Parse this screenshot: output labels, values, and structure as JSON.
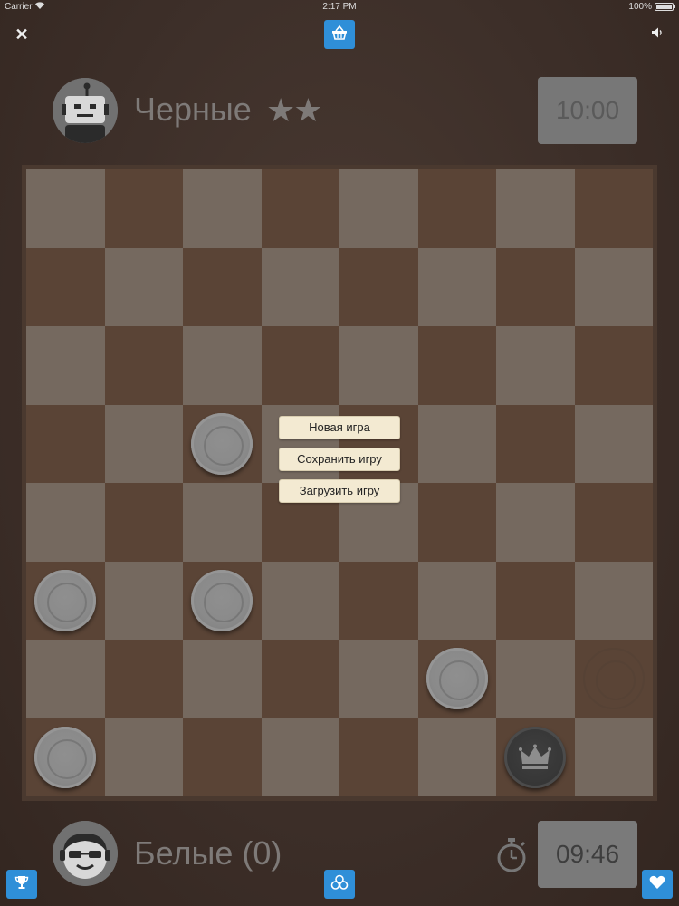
{
  "status_bar": {
    "carrier": "Carrier",
    "time": "2:17 PM",
    "battery": "100%"
  },
  "top_player": {
    "name": "Черные",
    "stars": "★★",
    "clock": "10:00",
    "avatar": "robot-icon"
  },
  "bottom_player": {
    "name": "Белые (0)",
    "clock": "09:46",
    "avatar": "sunglasses-face-icon"
  },
  "menu": {
    "new_game": "Новая игра",
    "save_game": "Сохранить игру",
    "load_game": "Загрузить игру"
  },
  "icons": {
    "close": "close-icon",
    "shop": "basket-icon",
    "sound": "speaker-icon",
    "trophy": "trophy-icon",
    "coins": "coins-icon",
    "heart": "heart-icon",
    "stopwatch": "stopwatch-icon"
  },
  "colors": {
    "accent": "#2f8fd8",
    "light_square": "#75695f",
    "dark_square": "#5a4436",
    "menu_bg": "#f3ead2"
  },
  "board": {
    "rows": 8,
    "cols": 8,
    "pieces": [
      {
        "row": 3,
        "col": 2,
        "type": "white"
      },
      {
        "row": 5,
        "col": 0,
        "type": "white"
      },
      {
        "row": 5,
        "col": 2,
        "type": "white"
      },
      {
        "row": 6,
        "col": 5,
        "type": "white"
      },
      {
        "row": 7,
        "col": 0,
        "type": "white"
      },
      {
        "row": 7,
        "col": 6,
        "type": "black-king"
      },
      {
        "row": 6,
        "col": 7,
        "type": "ghost"
      }
    ]
  }
}
